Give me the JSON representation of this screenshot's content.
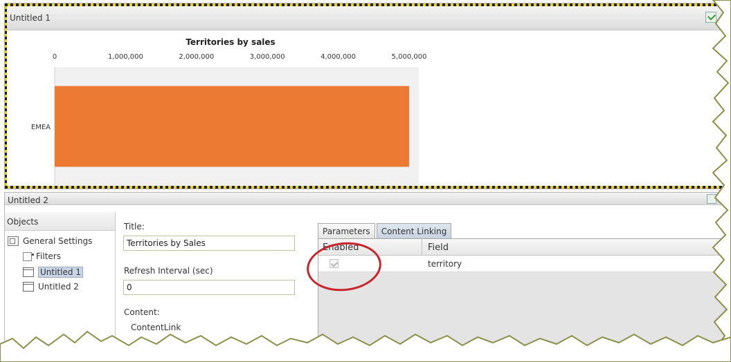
{
  "panel1": {
    "title": "Untitled 1"
  },
  "panel2": {
    "title": "Untitled 2"
  },
  "chart_data": {
    "type": "bar",
    "orientation": "horizontal",
    "title": "Territories by sales",
    "categories": [
      "EMEA"
    ],
    "values": [
      5000000
    ],
    "x_ticks": [
      0,
      1000000,
      2000000,
      3000000,
      4000000,
      5000000
    ],
    "x_tick_labels": [
      "0",
      "1,000,000",
      "2,000,000",
      "3,000,000",
      "4,000,000",
      "5,000,000"
    ],
    "xlim": [
      0,
      5000000
    ],
    "x_axis_position": "top",
    "bar_color": "#ed7a33",
    "grid": false
  },
  "objects": {
    "header": "Objects",
    "items": [
      {
        "label": "General Settings",
        "icon": "general-settings-icon"
      },
      {
        "label": "Filters",
        "icon": "filter-icon"
      },
      {
        "label": "Untitled 1",
        "icon": "window-icon"
      },
      {
        "label": "Untitled 2",
        "icon": "window-icon"
      }
    ]
  },
  "properties": {
    "title_label": "Title:",
    "title_value": "Territories by Sales",
    "refresh_label": "Refresh Interval (sec)",
    "refresh_value": "0",
    "content_label": "Content:",
    "content_value": "ContentLink"
  },
  "tabs": {
    "items": [
      "Parameters",
      "Content Linking"
    ],
    "active_index": 1,
    "grid": {
      "columns": [
        "Enabled",
        "Field"
      ],
      "rows": [
        {
          "enabled": true,
          "field": "territory"
        }
      ]
    }
  },
  "colors": {
    "bar": "#ed7a33",
    "highlight_circle": "#c8232a",
    "selected_item": "#c9d5e6",
    "hazard_dark": "#1d1d1d",
    "hazard_light": "#e8d21a"
  }
}
